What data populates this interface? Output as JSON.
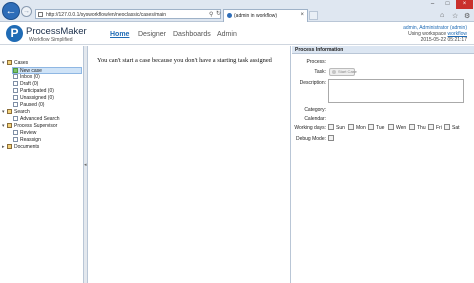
{
  "browser": {
    "url": "http://127.0.0.1/sysworkflow/en/neoclassic/cases/main",
    "tab_title": "(admin in workflow)",
    "tab_close": "×",
    "win_minimize": "–",
    "win_maximize": "□",
    "win_close": "×"
  },
  "header": {
    "logo_letter": "P",
    "logo_name": "ProcessMaker",
    "logo_tagline": "Workflow Simplified",
    "menu": [
      "Home",
      "Designer",
      "Dashboards",
      "Admin"
    ],
    "user_name": "admin, Administrator (admin)",
    "ws_prefix": "Using workspace",
    "ws_name": "workflow",
    "datetime": "2015-05-22 05:21:17"
  },
  "tree": {
    "cases": "Cases",
    "new_case": "New case",
    "inbox": "Inbox (0)",
    "draft": "Draft (0)",
    "participated": "Participated (0)",
    "unassigned": "Unassigned (0)",
    "paused": "Paused (0)",
    "search": "Search",
    "advanced_search": "Advanced Search",
    "supervisor": "Process Supervisor",
    "review": "Review",
    "reassign": "Reassign",
    "documents": "Documents"
  },
  "main": {
    "message": "You can't start a case because you don't have a starting task assigned"
  },
  "info": {
    "title": "Process Information",
    "process_label": "Process:",
    "task_label": "Task:",
    "start_button": "Start Case",
    "description_label": "Description:",
    "category_label": "Category:",
    "calendar_label": "Calendar:",
    "working_days_label": "Working days:",
    "days": [
      "Sun",
      "Mon",
      "Tue",
      "Wen",
      "Thu",
      "Fri",
      "Sat"
    ],
    "debug_label": "Debug Mode:"
  }
}
